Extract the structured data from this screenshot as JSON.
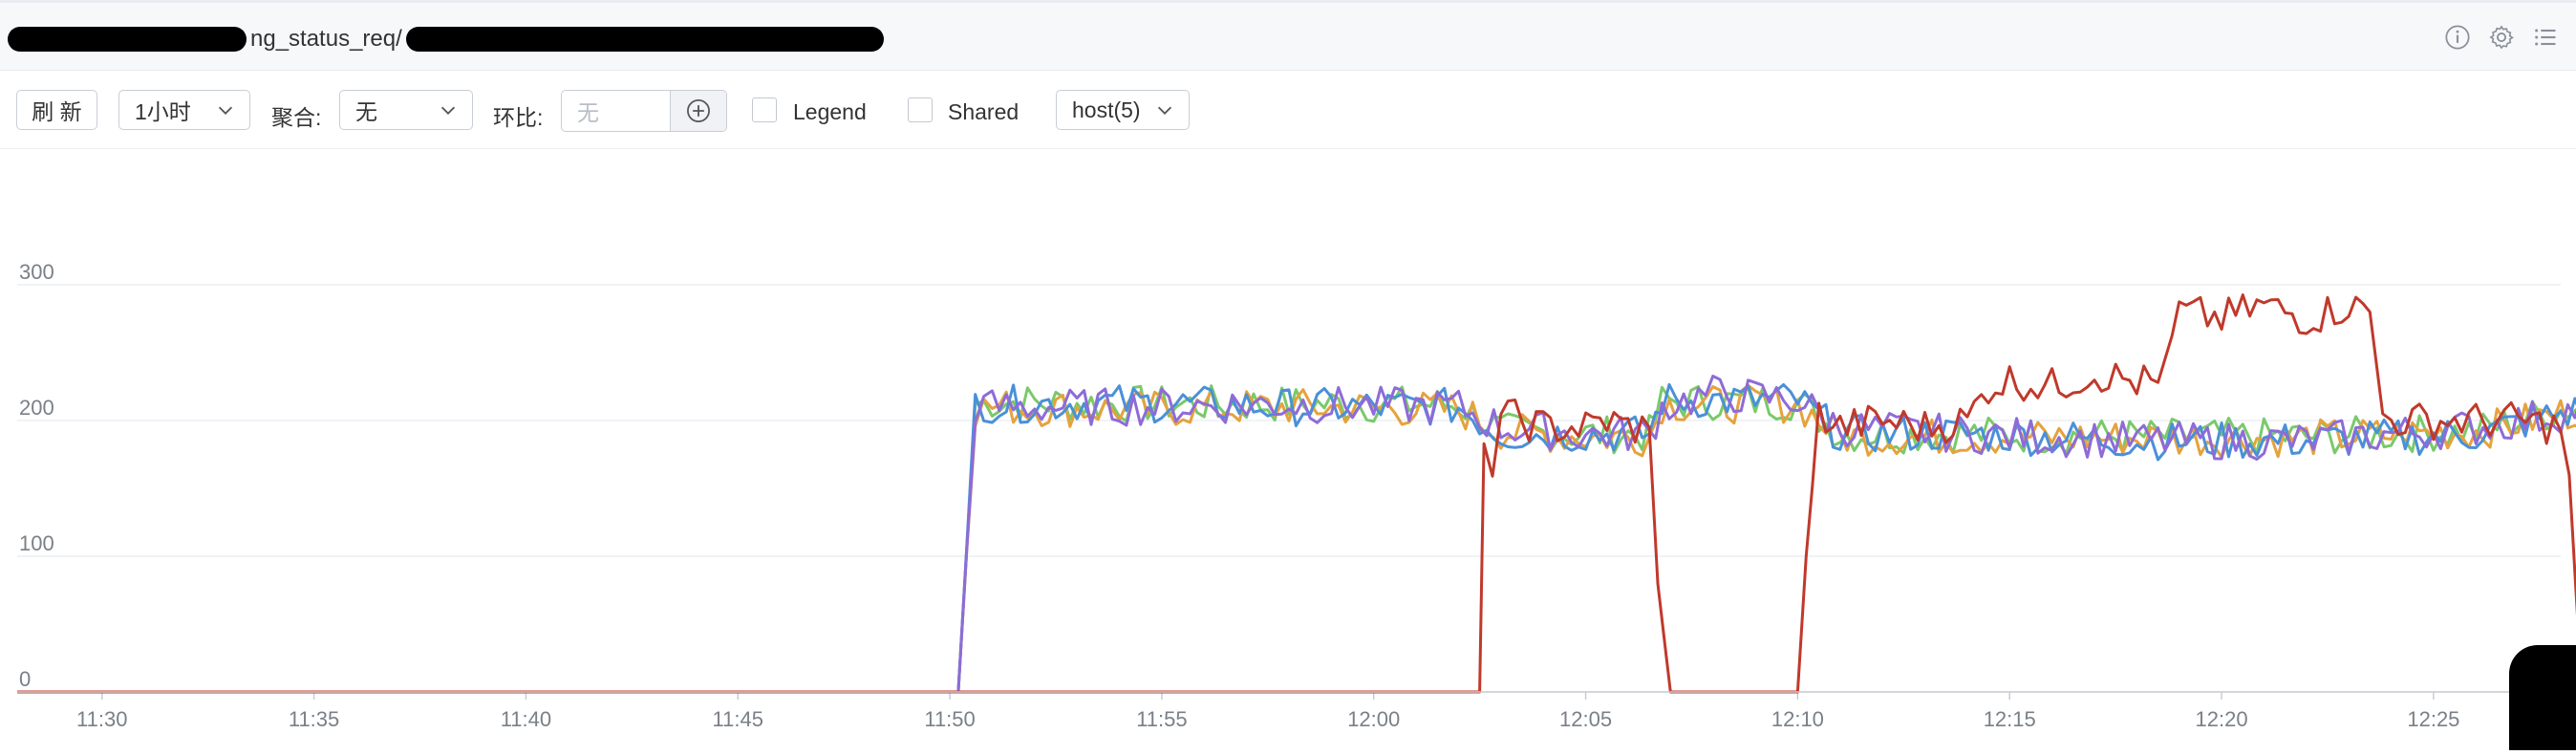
{
  "header": {
    "title": "ng_status_req/",
    "icons": [
      "info-icon",
      "gear-icon",
      "list-icon"
    ]
  },
  "toolbar": {
    "refresh_label": "刷 新",
    "time_range": "1小时",
    "aggregate_label": "聚合:",
    "aggregate_value": "无",
    "compare_label": "环比:",
    "compare_placeholder": "无",
    "legend_label": "Legend",
    "shared_label": "Shared",
    "host_select": "host(5)"
  },
  "colors": {
    "series": [
      "#c0392b",
      "#8e6bd8",
      "#4a90d9",
      "#e6a23c",
      "#7ac96b"
    ],
    "grid": "#eceff3"
  },
  "chart_data": {
    "type": "line",
    "xlabel": "",
    "ylabel": "",
    "x_ticks": [
      "11:30",
      "11:35",
      "11:40",
      "11:45",
      "11:50",
      "11:55",
      "12:00",
      "12:05",
      "12:10",
      "12:15",
      "12:20",
      "12:25"
    ],
    "y_ticks": [
      "0",
      "100",
      "200",
      "300"
    ],
    "ylim": [
      0,
      400
    ],
    "x_range_minutes": [
      -2,
      58
    ],
    "legend": "hidden",
    "grid": "horizontal",
    "series": [
      {
        "color": "#c0392b",
        "points": [
          [
            -2,
            0
          ],
          [
            32.5,
            0
          ],
          [
            32.6,
            170
          ],
          [
            32.8,
            170
          ],
          [
            33,
            205
          ],
          [
            34,
            195
          ],
          [
            35,
            195
          ],
          [
            35.5,
            200
          ],
          [
            36,
            195
          ],
          [
            36.5,
            195
          ],
          [
            36.7,
            80
          ],
          [
            37,
            0
          ],
          [
            40,
            0
          ],
          [
            40.2,
            100
          ],
          [
            40.5,
            205
          ],
          [
            41,
            195
          ],
          [
            42,
            200
          ],
          [
            43,
            195
          ],
          [
            44,
            200
          ],
          [
            44.5,
            225
          ],
          [
            45,
            230
          ],
          [
            46,
            225
          ],
          [
            47,
            235
          ],
          [
            48,
            228
          ],
          [
            48.5,
            228
          ],
          [
            49,
            280
          ],
          [
            50,
            275
          ],
          [
            51,
            285
          ],
          [
            52,
            275
          ],
          [
            53,
            285
          ],
          [
            53.5,
            280
          ],
          [
            53.8,
            205
          ],
          [
            54,
            200
          ],
          [
            55,
            200
          ],
          [
            56,
            200
          ],
          [
            57,
            200
          ],
          [
            58,
            195
          ],
          [
            58.2,
            160
          ],
          [
            58.5,
            0
          ],
          [
            60,
            0
          ]
        ]
      },
      {
        "color": "#8e6bd8",
        "points": [
          [
            -2,
            0
          ],
          [
            20.2,
            0
          ],
          [
            20.6,
            210
          ],
          [
            21,
            210
          ],
          [
            24,
            210
          ],
          [
            28,
            212
          ],
          [
            32,
            210
          ],
          [
            33,
            195
          ],
          [
            35,
            190
          ],
          [
            36.5,
            190
          ],
          [
            36.8,
            210
          ],
          [
            38,
            220
          ],
          [
            40,
            215
          ],
          [
            41,
            195
          ],
          [
            44,
            190
          ],
          [
            48,
            185
          ],
          [
            52,
            185
          ],
          [
            56,
            195
          ],
          [
            58,
            205
          ],
          [
            59,
            215
          ]
        ]
      },
      {
        "color": "#4a90d9",
        "points": [
          [
            -2,
            0
          ],
          [
            20.2,
            0
          ],
          [
            20.6,
            215
          ],
          [
            21,
            212
          ],
          [
            24,
            213
          ],
          [
            28,
            210
          ],
          [
            32,
            210
          ],
          [
            33,
            190
          ],
          [
            35,
            190
          ],
          [
            36.5,
            190
          ],
          [
            36.8,
            215
          ],
          [
            38,
            215
          ],
          [
            40,
            215
          ],
          [
            41,
            190
          ],
          [
            44,
            190
          ],
          [
            48,
            185
          ],
          [
            52,
            185
          ],
          [
            56,
            190
          ],
          [
            58,
            205
          ],
          [
            59,
            210
          ]
        ]
      },
      {
        "color": "#e6a23c",
        "points": [
          [
            -2,
            0
          ],
          [
            20.2,
            0
          ],
          [
            20.6,
            208
          ],
          [
            21,
            210
          ],
          [
            24,
            208
          ],
          [
            28,
            210
          ],
          [
            32,
            208
          ],
          [
            33,
            192
          ],
          [
            35,
            188
          ],
          [
            36.5,
            188
          ],
          [
            36.8,
            212
          ],
          [
            38,
            212
          ],
          [
            40,
            212
          ],
          [
            41,
            188
          ],
          [
            44,
            188
          ],
          [
            48,
            187
          ],
          [
            52,
            187
          ],
          [
            56,
            192
          ],
          [
            58,
            205
          ],
          [
            59,
            210
          ]
        ]
      },
      {
        "color": "#7ac96b",
        "points": [
          [
            -2,
            0
          ],
          [
            18.5,
            0
          ],
          [
            19.5,
            0
          ],
          [
            20.2,
            0
          ],
          [
            20.6,
            212
          ],
          [
            21,
            214
          ],
          [
            24,
            212
          ],
          [
            28,
            212
          ],
          [
            32,
            212
          ],
          [
            33,
            192
          ],
          [
            35,
            190
          ],
          [
            36.5,
            190
          ],
          [
            36.8,
            214
          ],
          [
            38,
            214
          ],
          [
            40,
            214
          ],
          [
            41,
            190
          ],
          [
            44,
            190
          ],
          [
            48,
            188
          ],
          [
            52,
            188
          ],
          [
            56,
            192
          ],
          [
            58,
            208
          ],
          [
            59,
            214
          ]
        ]
      }
    ]
  }
}
